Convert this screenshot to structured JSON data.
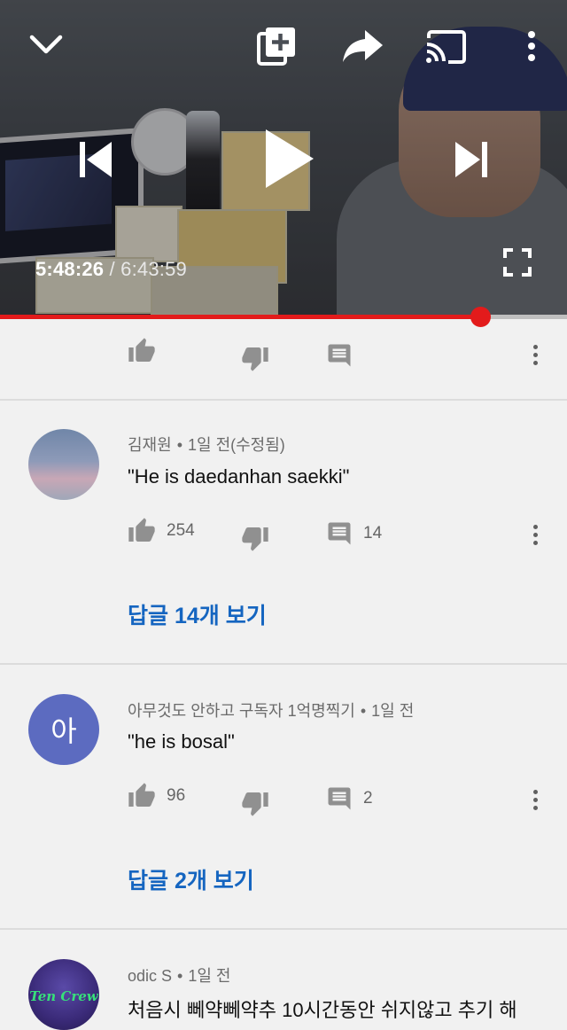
{
  "player": {
    "current_time": "5:48:26",
    "separator": "/",
    "total_time": "6:43:59",
    "progress": 0.848,
    "icons": [
      "chevron-down-icon",
      "add-to-playlist-icon",
      "share-icon",
      "cast-icon",
      "more-vert-icon",
      "previous-icon",
      "play-icon",
      "next-icon",
      "fullscreen-icon"
    ]
  },
  "comments": [
    {
      "author": "김재원",
      "time": "1일 전(수정됨)",
      "text": "\"He is daedanhan saekki\"",
      "likes": "254",
      "replies_count": "14",
      "view_replies": "답글 14개 보기",
      "avatar": "sky-photo"
    },
    {
      "author": "아무것도 안하고 구독자 1억명찍기",
      "time": "1일 전",
      "text": "\"he is bosal\"",
      "likes": "96",
      "replies_count": "2",
      "view_replies": "답글 2개 보기",
      "avatar_letter": "아",
      "avatar_color": "#5c6bc0"
    },
    {
      "author": "odic S",
      "time": "1일 전",
      "text": "처음시 뻬약뻬약추 10시간동안 쉬지않고 추기 해",
      "avatar_text": "Ten Crew"
    }
  ],
  "colors": {
    "accent_red": "#e31b1b",
    "link_blue": "#1565c0",
    "background": "#f1f1f1"
  }
}
